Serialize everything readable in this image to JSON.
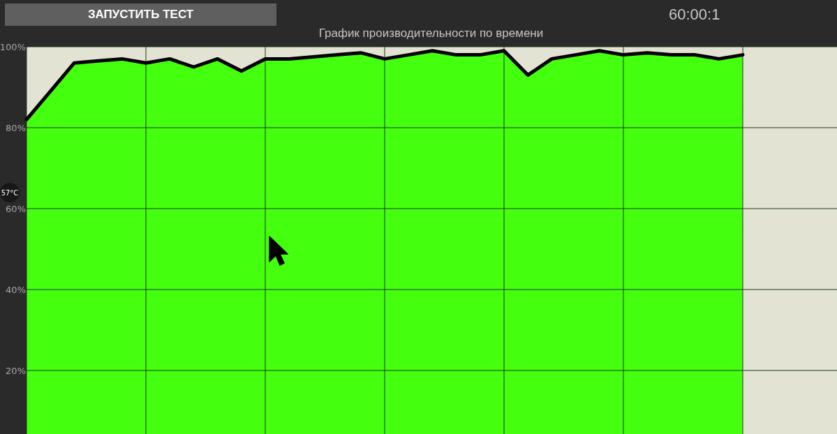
{
  "toolbar": {
    "start_button": "ЗАПУСТИТЬ ТЕСТ",
    "timer": "60:00:1"
  },
  "temperature_badge": "57°C",
  "performance_chart": {
    "chart_data": {
      "type": "line",
      "title": "График производительности по времени",
      "categories": [
        null,
        null,
        null,
        null,
        null,
        null,
        null,
        null,
        null,
        null,
        null,
        null,
        null,
        null,
        null,
        null,
        null,
        null,
        null,
        null,
        null,
        null,
        null,
        null,
        null,
        null,
        null,
        null,
        null,
        null,
        null
      ],
      "series": [
        {
          "color": "#000000",
          "values": [
            82,
            89,
            96,
            96.5,
            97,
            96,
            97,
            95,
            97,
            94,
            97,
            97,
            97.5,
            98,
            98.5,
            97,
            98,
            99,
            98,
            98,
            99,
            93,
            97,
            98,
            99,
            98,
            98.5,
            98,
            98,
            97,
            98
          ]
        }
      ],
      "ylim": [
        4.3,
        100
      ],
      "grid": true,
      "yticks": [
        {
          "value": 20,
          "label": "20%"
        },
        {
          "value": 40,
          "label": "40%"
        },
        {
          "value": 60,
          "label": "60%"
        },
        {
          "value": 80,
          "label": "80%"
        },
        {
          "value": 100,
          "label": "100%"
        }
      ]
    }
  }
}
